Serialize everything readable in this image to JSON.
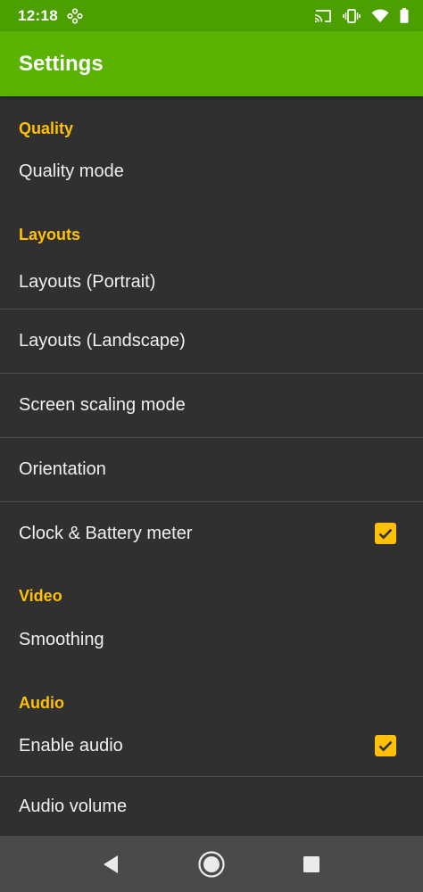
{
  "status_bar": {
    "time": "12:18",
    "icons": [
      "game-notification-icon",
      "cast-icon",
      "vibrate-icon",
      "wifi-icon",
      "battery-icon"
    ]
  },
  "app_bar": {
    "title": "Settings"
  },
  "sections": {
    "quality": {
      "header": "Quality",
      "items": [
        {
          "title": "Quality mode"
        }
      ]
    },
    "layouts": {
      "header": "Layouts",
      "items": [
        {
          "title": "Layouts (Portrait)"
        },
        {
          "title": "Layouts (Landscape)"
        },
        {
          "title": "Screen scaling mode"
        },
        {
          "title": "Orientation"
        },
        {
          "title": "Clock & Battery meter",
          "checked": true
        }
      ]
    },
    "video": {
      "header": "Video",
      "items": [
        {
          "title": "Smoothing"
        }
      ]
    },
    "audio": {
      "header": "Audio",
      "items": [
        {
          "title": "Enable audio",
          "checked": true
        },
        {
          "title": "Audio volume"
        }
      ]
    }
  },
  "nav_bar": {
    "buttons": [
      "back-icon",
      "home-icon",
      "recents-icon"
    ]
  },
  "colors": {
    "status_bar": "#4c9f00",
    "app_bar": "#59b300",
    "background": "#303030",
    "accent": "#ffc107",
    "nav_bar": "#4a4a4a"
  }
}
